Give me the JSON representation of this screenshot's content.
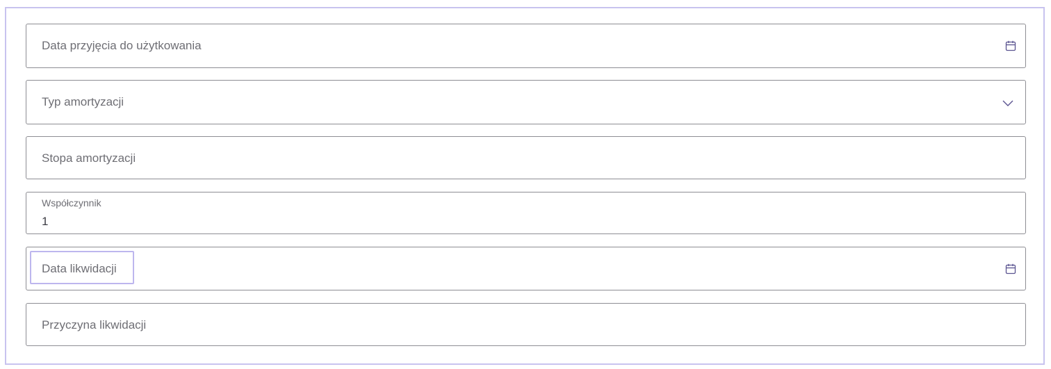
{
  "form": {
    "fields": [
      {
        "label": "Data przyjęcia do użytkowania",
        "icon": "calendar-icon"
      },
      {
        "label": "Typ amortyzacji",
        "icon": "chevron-down-icon"
      },
      {
        "label": "Stopa amortyzacji"
      },
      {
        "label": "Współczynnik",
        "value": "1"
      },
      {
        "label": "Data likwidacji",
        "icon": "calendar-icon"
      },
      {
        "label": "Przyczyna likwidacji"
      }
    ]
  },
  "colors": {
    "frame_border": "#c8c3ef",
    "field_border": "#8d8d93",
    "icon": "#5a5390",
    "label": "#6e6e74"
  }
}
